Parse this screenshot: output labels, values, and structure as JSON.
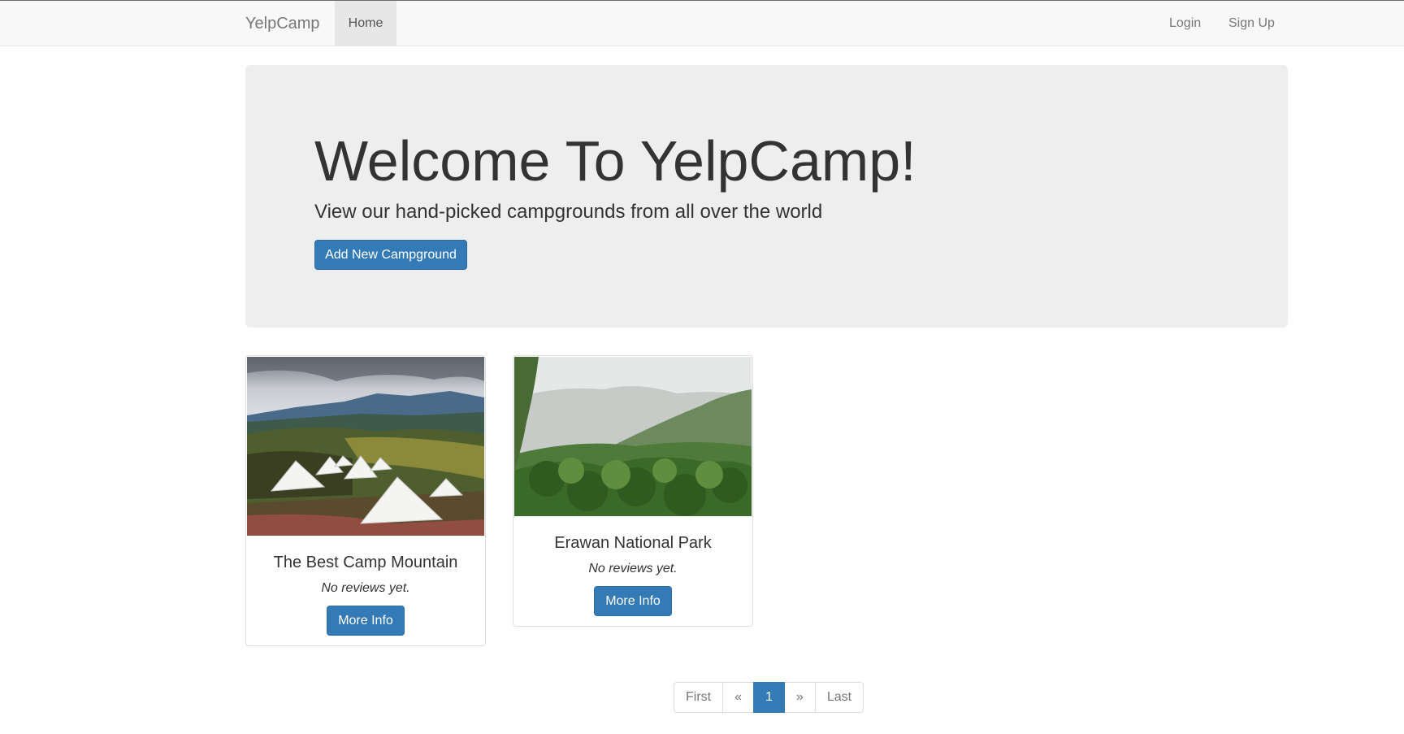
{
  "navbar": {
    "brand": "YelpCamp",
    "home": "Home",
    "login": "Login",
    "signup": "Sign Up"
  },
  "jumbotron": {
    "title": "Welcome To YelpCamp!",
    "subtitle": "View our hand-picked campgrounds from all over the world",
    "button": "Add New Campground"
  },
  "campgrounds": [
    {
      "name": "The Best Camp Mountain",
      "reviews": "No reviews yet.",
      "button": "More Info",
      "image": "mountain-tents-photo"
    },
    {
      "name": "Erawan National Park",
      "reviews": "No reviews yet.",
      "button": "More Info",
      "image": "misty-forest-photo"
    }
  ],
  "pagination": {
    "first": "First",
    "prev": "«",
    "current": "1",
    "next": "»",
    "last": "Last"
  },
  "colors": {
    "primary": "#337ab7",
    "navbar_bg": "#f8f8f8",
    "jumbotron_bg": "#eeeeee"
  }
}
